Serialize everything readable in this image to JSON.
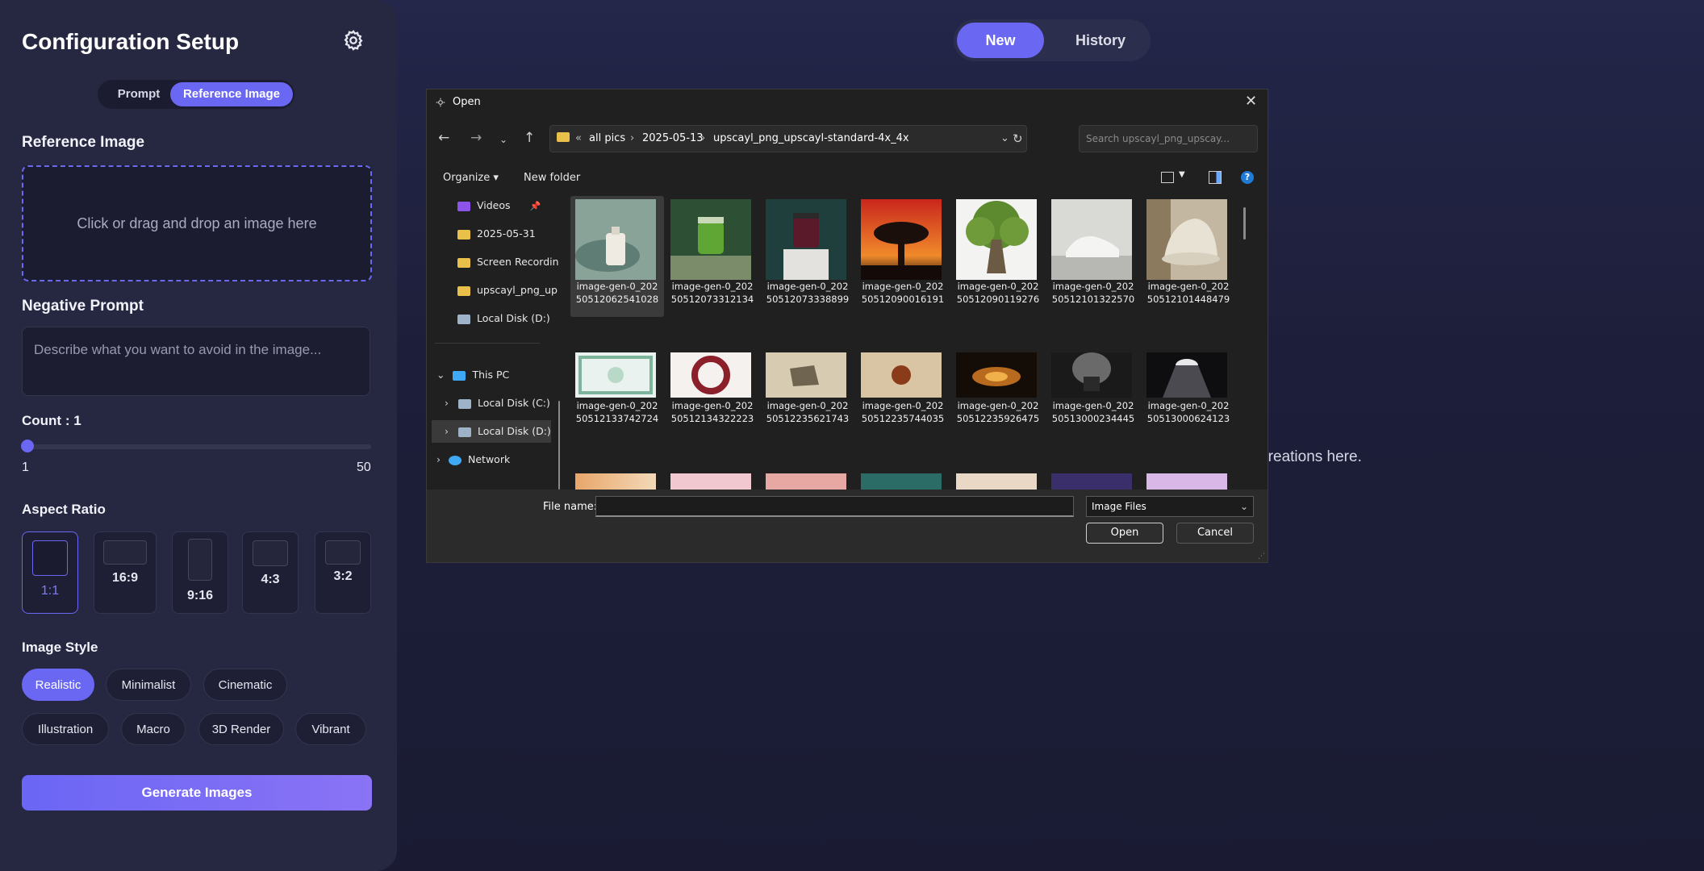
{
  "sidebar": {
    "title": "Configuration Setup",
    "mode_tabs": [
      "Prompt",
      "Reference Image"
    ],
    "reference_label": "Reference Image",
    "dropzone_text": "Click or drag and drop an image here",
    "negative_label": "Negative Prompt",
    "negative_placeholder": "Describe what you want to avoid in the image...",
    "count_label": "Count : 1",
    "count_min": "1",
    "count_max": "50",
    "count_value": 1,
    "aspect_label": "Aspect Ratio",
    "aspect_ratios": [
      "1:1",
      "16:9",
      "9:16",
      "4:3",
      "3:2"
    ],
    "aspect_selected": "1:1",
    "style_label": "Image Style",
    "styles": [
      "Realistic",
      "Minimalist",
      "Cinematic",
      "Illustration",
      "Macro",
      "3D Render",
      "Vibrant"
    ],
    "style_selected": "Realistic",
    "generate_label": "Generate Images"
  },
  "top_toggle": {
    "new": "New",
    "history": "History"
  },
  "empty_state_text": "ur creations here.",
  "dialog": {
    "title": "Open",
    "close": "✕",
    "path": {
      "prefix": "«",
      "segments": [
        "all pics",
        "2025-05-13",
        "upscayl_png_upscayl-standard-4x_4x"
      ]
    },
    "search_placeholder": "Search upscayl_png_upscay...",
    "organize": "Organize ▾",
    "new_folder": "New folder",
    "tree": [
      "Videos",
      "2025-05-31",
      "Screen Recordin",
      "upscayl_png_up",
      "Local Disk (D:)",
      "This PC",
      "Local Disk (C:)",
      "Local Disk (D:)",
      "Network"
    ],
    "files": [
      [
        "image-gen-0_202",
        "50512062541028"
      ],
      [
        "image-gen-0_202",
        "50512073312134"
      ],
      [
        "image-gen-0_202",
        "50512073338899"
      ],
      [
        "image-gen-0_202",
        "50512090016191"
      ],
      [
        "image-gen-0_202",
        "50512090119276"
      ],
      [
        "image-gen-0_202",
        "50512101322570"
      ],
      [
        "image-gen-0_202",
        "50512101448479"
      ],
      [
        "image-gen-0_202",
        "50512133742724"
      ],
      [
        "image-gen-0_202",
        "50512134322223"
      ],
      [
        "image-gen-0_202",
        "50512235621743"
      ],
      [
        "image-gen-0_202",
        "50512235744035"
      ],
      [
        "image-gen-0_202",
        "50512235926475"
      ],
      [
        "image-gen-0_202",
        "50513000234445"
      ],
      [
        "image-gen-0_202",
        "50513000624123"
      ]
    ],
    "file_name_label": "File name:",
    "file_name_value": "",
    "file_type": "Image Files",
    "open_button": "Open",
    "cancel_button": "Cancel"
  },
  "colors": {
    "accent": "#6a67f3",
    "sidebar_bg": "#262740",
    "dialog_bg": "#202020"
  }
}
